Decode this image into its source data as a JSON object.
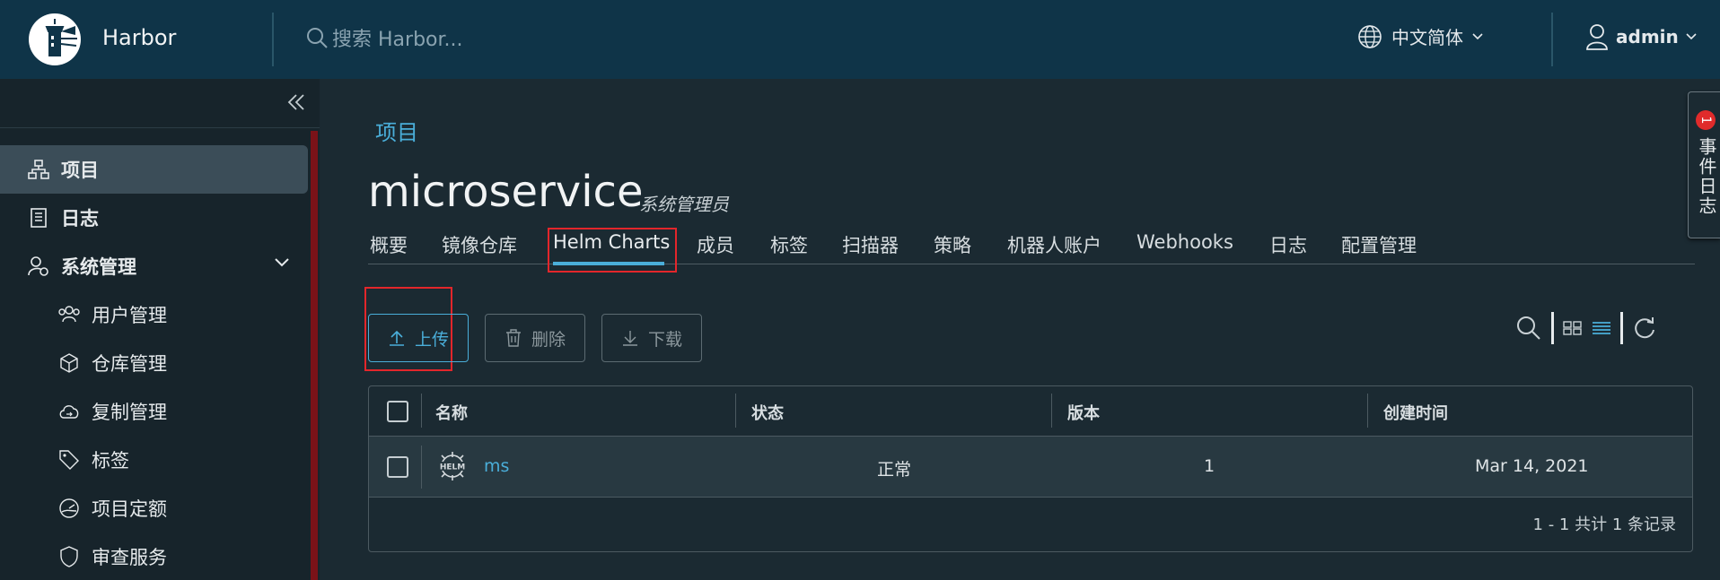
{
  "header": {
    "brand": "Harbor",
    "search_placeholder": "搜索 Harbor...",
    "language": "中文简体",
    "user": "admin"
  },
  "sidebar": {
    "items": [
      {
        "label": "项目",
        "icon": "projects-icon",
        "active": true
      },
      {
        "label": "日志",
        "icon": "log-icon"
      },
      {
        "label": "系统管理",
        "icon": "system-admin-icon"
      },
      {
        "label": "用户管理",
        "icon": "users-icon"
      },
      {
        "label": "仓库管理",
        "icon": "registry-icon"
      },
      {
        "label": "复制管理",
        "icon": "replication-icon"
      },
      {
        "label": "标签",
        "icon": "tag-icon"
      },
      {
        "label": "项目定额",
        "icon": "quota-icon"
      },
      {
        "label": "审查服务",
        "icon": "shield-icon"
      }
    ]
  },
  "main": {
    "breadcrumb": "项目",
    "project_name": "microservice",
    "project_role": "系统管理员",
    "tabs": [
      "概要",
      "镜像仓库",
      "Helm Charts",
      "成员",
      "标签",
      "扫描器",
      "策略",
      "机器人账户",
      "Webhooks",
      "日志",
      "配置管理"
    ],
    "active_tab": "Helm Charts",
    "buttons": {
      "upload": "上传",
      "delete": "删除",
      "download": "下载"
    },
    "table": {
      "headers": [
        "名称",
        "状态",
        "版本",
        "创建时间"
      ],
      "rows": [
        {
          "icon": "helm-icon",
          "name": "ms",
          "status": "正常",
          "version": "1",
          "created": "Mar 14, 2021"
        }
      ],
      "footer": "1 - 1 共计 1 条记录"
    }
  },
  "event_log": {
    "label": "事件日志",
    "count": "1"
  },
  "colors": {
    "header_bg": "#0f3448",
    "accent": "#4aaed9",
    "highlight_box": "#e3262b"
  }
}
